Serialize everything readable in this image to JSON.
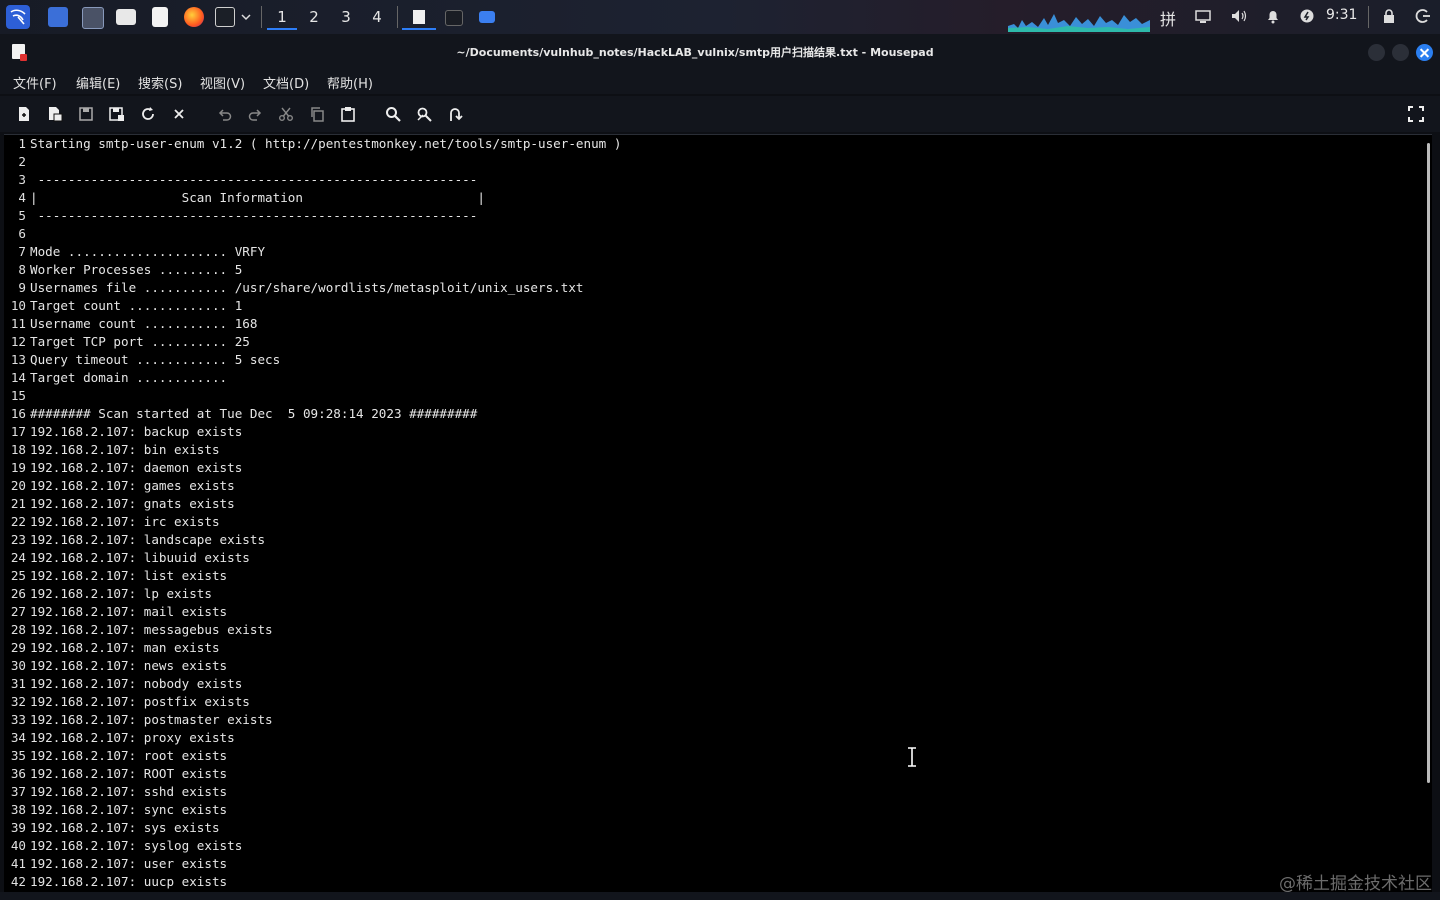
{
  "panel": {
    "workspaces": [
      "1",
      "2",
      "3",
      "4"
    ],
    "active_workspace": "1",
    "clock": "9:31",
    "input_method": "拼",
    "accent": "#2d7df6",
    "icons": [
      "kali-menu-icon",
      "desktop-icon",
      "monitor-icon",
      "file-manager-icon",
      "mousepad-icon",
      "firefox-icon",
      "terminal-icon",
      "dropdown-icon",
      "mousepad-task-icon",
      "terminal-task-icon",
      "folder-task-icon",
      "input-method-icon",
      "display-icon",
      "volume-icon",
      "notification-icon",
      "power-manager-icon",
      "lock-icon",
      "logout-icon"
    ]
  },
  "window": {
    "title": "~/Documents/vulnhub_notes/HackLAB_vulnix/smtp用户扫描结果.txt - Mousepad"
  },
  "menu": {
    "items": [
      "文件(F)",
      "编辑(E)",
      "搜索(S)",
      "视图(V)",
      "文档(D)",
      "帮助(H)"
    ]
  },
  "toolbar": {
    "buttons": [
      "new-document",
      "new-window",
      "save",
      "save-as",
      "reload",
      "close",
      "undo",
      "redo",
      "cut",
      "copy",
      "paste",
      "find",
      "find-replace",
      "go-to-line",
      "fullscreen"
    ]
  },
  "editor": {
    "lines": [
      "Starting smtp-user-enum v1.2 ( http://pentestmonkey.net/tools/smtp-user-enum )",
      "",
      " ----------------------------------------------------------",
      "|                   Scan Information                       |",
      " ----------------------------------------------------------",
      "",
      "Mode ..................... VRFY",
      "Worker Processes ......... 5",
      "Usernames file ........... /usr/share/wordlists/metasploit/unix_users.txt",
      "Target count ............. 1",
      "Username count ........... 168",
      "Target TCP port .......... 25",
      "Query timeout ............ 5 secs",
      "Target domain ............",
      "",
      "######## Scan started at Tue Dec  5 09:28:14 2023 #########",
      "192.168.2.107: backup exists",
      "192.168.2.107: bin exists",
      "192.168.2.107: daemon exists",
      "192.168.2.107: games exists",
      "192.168.2.107: gnats exists",
      "192.168.2.107: irc exists",
      "192.168.2.107: landscape exists",
      "192.168.2.107: libuuid exists",
      "192.168.2.107: list exists",
      "192.168.2.107: lp exists",
      "192.168.2.107: mail exists",
      "192.168.2.107: messagebus exists",
      "192.168.2.107: man exists",
      "192.168.2.107: news exists",
      "192.168.2.107: nobody exists",
      "192.168.2.107: postfix exists",
      "192.168.2.107: postmaster exists",
      "192.168.2.107: proxy exists",
      "192.168.2.107: root exists",
      "192.168.2.107: ROOT exists",
      "192.168.2.107: sshd exists",
      "192.168.2.107: sync exists",
      "192.168.2.107: sys exists",
      "192.168.2.107: syslog exists",
      "192.168.2.107: user exists",
      "192.168.2.107: uucp exists"
    ]
  },
  "watermark": "@稀土掘金技术社区"
}
